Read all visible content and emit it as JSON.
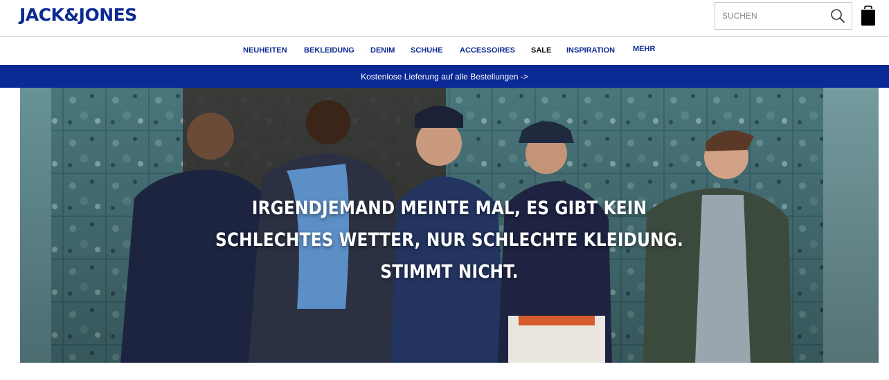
{
  "header": {
    "logo": "JACK&JONES",
    "search": {
      "placeholder": "SUCHEN",
      "icon": "search-icon"
    },
    "bag_icon": "shopping-bag-icon"
  },
  "nav": {
    "items": [
      {
        "label": "NEUHEITEN"
      },
      {
        "label": "BEKLEIDUNG"
      },
      {
        "label": "DENIM"
      },
      {
        "label": "SCHUHE"
      },
      {
        "label": "ACCESSOIRES"
      },
      {
        "label": "SALE"
      },
      {
        "label": "INSPIRATION"
      },
      {
        "label": "MEHR"
      }
    ]
  },
  "promo": {
    "text": "Kostenlose Lieferung auf alle Bestellungen ->",
    "color": "#0b2a96"
  },
  "hero": {
    "lines": [
      "IRGENDJEMAND MEINTE MAL, ES GIBT KEIN",
      "SCHLECHTES WETTER, NUR SCHLECHTE KLEIDUNG.",
      "STIMMT NICHT."
    ]
  },
  "colors": {
    "brand": "#0c2a92",
    "text_dark": "#111111"
  }
}
